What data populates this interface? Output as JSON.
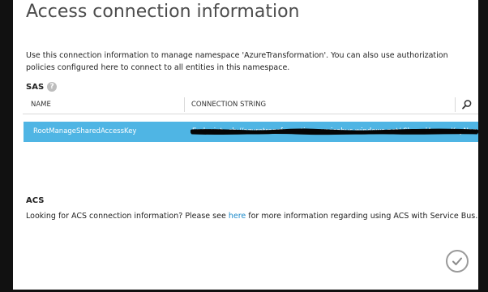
{
  "dialog": {
    "title": "Access connection information",
    "description": "Use this connection information to manage namespace 'AzureTransformation'. You can also use authorization policies configured here to connect to all entities in this namespace."
  },
  "sas": {
    "heading": "SAS",
    "help_icon": "help-icon",
    "columns": {
      "name": "NAME",
      "connection_string": "CONNECTION STRING"
    },
    "search_icon": "search-icon",
    "rows": [
      {
        "name": "RootManageSharedAccessKey",
        "connection_string": "Endpoint=sb://azuretransformation.servicebus.windows.net/;SharedAccessKeyName=RootManageSharedAccessKey"
      }
    ],
    "row_selected_color": "#4fb5e4"
  },
  "acs": {
    "heading": "ACS",
    "text_before": "Looking for ACS connection information? Please see ",
    "link": "here",
    "text_after": " for more information regarding using ACS with Service Bus."
  },
  "footer": {
    "ok_icon": "checkmark-icon"
  }
}
